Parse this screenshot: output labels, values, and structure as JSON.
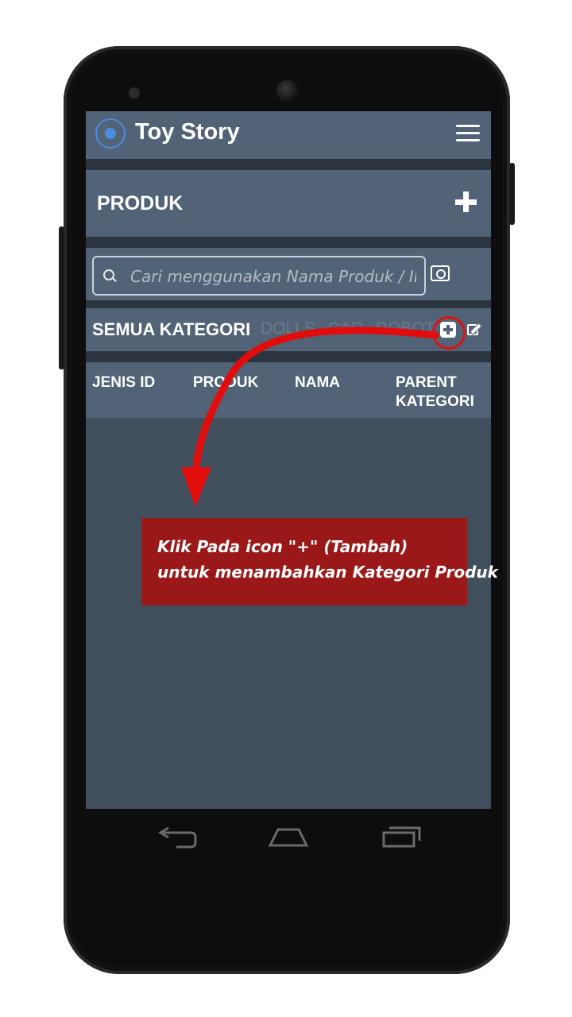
{
  "app": {
    "title": "Toy Story"
  },
  "section": {
    "title": "PRODUK"
  },
  "search": {
    "placeholder": "Cari menggunakan Nama Produk / ID",
    "value": ""
  },
  "kategori": {
    "title": "SEMUA KATEGORI",
    "chips": [
      "DOLLS",
      "CAR",
      "ROBOT"
    ]
  },
  "table": {
    "headers": [
      "JENIS ID",
      "PRODUK",
      "NAMA",
      "PARENT KATEGORI"
    ]
  },
  "callout": {
    "line1": "Klik Pada icon \"+\" (Tambah)",
    "line2": "untuk menambahkan Kategori Produk"
  },
  "icons": {
    "logo": "ionic-logo-icon",
    "menu": "hamburger-menu-icon",
    "add": "plus-icon",
    "search": "search-icon",
    "camera": "camera-icon",
    "add_kategori": "plus-square-icon",
    "edit": "edit-icon",
    "back": "back-icon",
    "home": "home-icon",
    "recents": "recents-icon"
  },
  "colors": {
    "bar": "#526377",
    "screen": "#414e5c",
    "accent": "#4b8de0",
    "callout": "#9b1818",
    "highlight": "#dd1111"
  }
}
